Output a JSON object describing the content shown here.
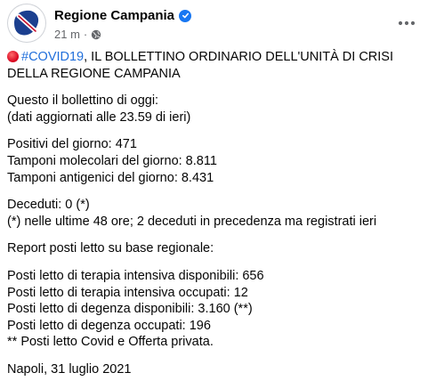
{
  "header": {
    "page_name": "Regione Campania",
    "time": "21 m",
    "separator": "·",
    "avatar_icon": "regione-campania-logo",
    "verified_icon": "verified-badge-icon",
    "privacy_icon": "globe-icon",
    "more_icon": "more-options-icon"
  },
  "post": {
    "hashtag": "#COVID19",
    "headline_rest": ", IL BOLLETTINO ORDINARIO DELL'UNITÀ  DI CRISI DELLA REGIONE CAMPANIA",
    "intro": [
      "Questo il bollettino di oggi:",
      "(dati aggiornati alle 23.59 di ieri)"
    ],
    "tests": [
      "Positivi del giorno: 471",
      "Tamponi molecolari del giorno: 8.811",
      "Tamponi antigenici del giorno: 8.431"
    ],
    "deaths": [
      "Deceduti: 0 (*)",
      "(*) nelle ultime 48 ore; 2 deceduti in precedenza ma registrati ieri"
    ],
    "report_title": "Report posti letto su base regionale:",
    "beds": [
      "Posti letto di terapia intensiva disponibili: 656",
      "Posti letto di terapia intensiva occupati: 12",
      "Posti letto di degenza disponibili: 3.160 (**)",
      "Posti letto di degenza occupati: 196",
      "** Posti letto Covid e Offerta privata."
    ],
    "signature": "Napoli, 31 luglio 2021"
  },
  "colors": {
    "link": "#216fdb",
    "meta": "#65676b",
    "verified": "#1877f2",
    "logo_blue": "#1b3f8f",
    "red_dot": "#d6001c"
  }
}
